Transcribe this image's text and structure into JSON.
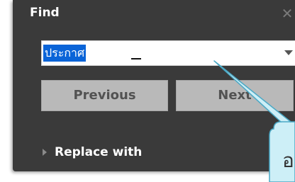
{
  "find_panel": {
    "title": "Find",
    "close_icon": "close-icon",
    "search": {
      "value": "ประกาศ",
      "dropdown_icon": "chevron-down-icon"
    },
    "buttons": {
      "previous": "Previous",
      "next": "Next"
    },
    "replace_toggle": {
      "label": "Replace with",
      "icon": "triangle-right-icon"
    }
  },
  "callout": {
    "text": "อ",
    "fill": "#cdeff7",
    "stroke": "#4aa8c5"
  },
  "colors": {
    "panel_bg": "#3a3a3a",
    "selection": "#0a64d8",
    "button_bg": "#b9b9b9"
  }
}
